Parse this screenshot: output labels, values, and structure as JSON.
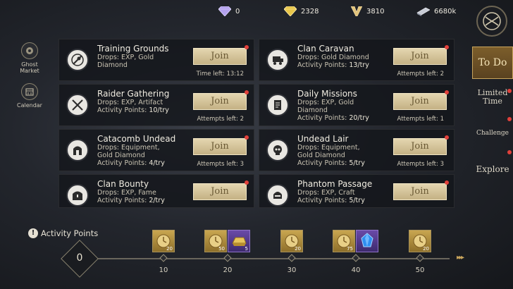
{
  "currencies": [
    {
      "name": "diamond",
      "value": "0",
      "color": "#b9a8f0"
    },
    {
      "name": "gold-diamond",
      "value": "2328",
      "color": "#e8c64a"
    },
    {
      "name": "v-currency",
      "value": "3810",
      "color": "#e2c37a"
    },
    {
      "name": "silver-bar",
      "value": "6680k",
      "color": "#c8ccd6"
    }
  ],
  "rail": {
    "ghost_market": "Ghost Market",
    "calendar": "Calendar"
  },
  "join_label": "Join",
  "cards": [
    {
      "name": "Training Grounds",
      "desc1": "Drops: EXP, Gold",
      "desc2": "Diamond",
      "desc3": "",
      "desc3num": "",
      "meta": "Time left: 13:12",
      "icon": "crossed-swords-icon"
    },
    {
      "name": "Clan Caravan",
      "desc1": "Drops: Gold Diamond",
      "desc2": "",
      "desc3": "Activity Points: ",
      "desc3num": "13/try",
      "meta": "Attempts left: 2",
      "icon": "wagon-icon"
    },
    {
      "name": "Raider Gathering",
      "desc1": "Drops: EXP, Artifact",
      "desc2": "",
      "desc3": "Activity Points: ",
      "desc3num": "10/try",
      "meta": "Attempts left: 2",
      "icon": "swords-icon"
    },
    {
      "name": "Daily Missions",
      "desc1": "Drops: EXP, Gold",
      "desc2": "Diamond",
      "desc3": "Activity Points: ",
      "desc3num": "20/try",
      "meta": "Attempts left: 1",
      "icon": "scroll-icon"
    },
    {
      "name": "Catacomb Undead",
      "desc1": "Drops: Equipment,",
      "desc2": "Gold Diamond",
      "desc3": "Activity Points: ",
      "desc3num": "4/try",
      "meta": "Attempts left: 3",
      "icon": "tomb-icon"
    },
    {
      "name": "Undead Lair",
      "desc1": "Drops: Equipment,",
      "desc2": "Gold Diamond",
      "desc3": "Activity Points: ",
      "desc3num": "5/try",
      "meta": "Attempts left: 3",
      "icon": "skull-icon"
    },
    {
      "name": "Clan Bounty",
      "desc1": "Drops: EXP, Fame",
      "desc2": "",
      "desc3": "Activity Points: ",
      "desc3num": "2/try",
      "meta": "",
      "icon": "chest-icon"
    },
    {
      "name": "Phantom Passage",
      "desc1": "Drops: EXP, Craft",
      "desc2": "",
      "desc3": "Activity Points: ",
      "desc3num": "5/try",
      "meta": "",
      "icon": "helmet-icon"
    }
  ],
  "tabs": {
    "todo": "To Do",
    "limited_time": "Limited Time",
    "challenge": "Challenge",
    "explore": "Explore"
  },
  "activity": {
    "label": "Activity Points",
    "current": "0",
    "milestones": [
      "10",
      "20",
      "30",
      "40",
      "50"
    ]
  },
  "rewards": [
    {
      "kind": "gold-chest",
      "count": "20"
    },
    {
      "kind": "gold-chest",
      "count": "50"
    },
    {
      "kind": "gold-ingot",
      "count": "5"
    },
    {
      "kind": "gold-chest",
      "count": "20"
    },
    {
      "kind": "gold-chest",
      "count": "75"
    },
    {
      "kind": "blue-gem",
      "count": ""
    },
    {
      "kind": "gold-chest",
      "count": "20"
    }
  ]
}
